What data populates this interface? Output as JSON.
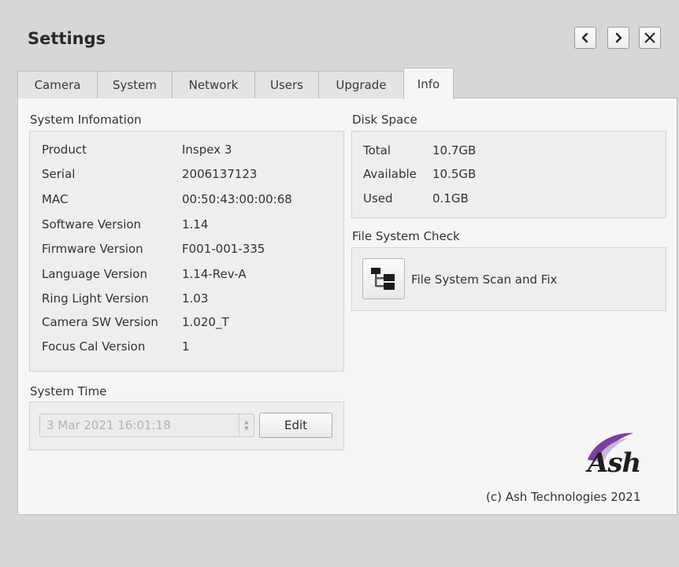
{
  "window": {
    "title": "Settings"
  },
  "nav": {
    "prev": "<",
    "next": ">",
    "close": "X"
  },
  "tabs": [
    {
      "label": "Camera"
    },
    {
      "label": "System"
    },
    {
      "label": "Network"
    },
    {
      "label": "Users"
    },
    {
      "label": "Upgrade"
    },
    {
      "label": "Info"
    }
  ],
  "active_tab": "Info",
  "system_info": {
    "heading": "System Infomation",
    "rows": [
      {
        "label": "Product",
        "value": "Inspex 3"
      },
      {
        "label": "Serial",
        "value": "2006137123"
      },
      {
        "label": "MAC",
        "value": "00:50:43:00:00:68"
      },
      {
        "label": "Software Version",
        "value": "1.14"
      },
      {
        "label": "Firmware Version",
        "value": "F001-001-335"
      },
      {
        "label": "Language Version",
        "value": "1.14-Rev-A"
      },
      {
        "label": "Ring Light Version",
        "value": "1.03"
      },
      {
        "label": "Camera SW Version",
        "value": "1.020_T"
      },
      {
        "label": "Focus Cal Version",
        "value": "1"
      }
    ]
  },
  "disk_space": {
    "heading": "Disk Space",
    "rows": [
      {
        "label": "Total",
        "value": "10.7GB"
      },
      {
        "label": "Available",
        "value": "10.5GB"
      },
      {
        "label": "Used",
        "value": "0.1GB"
      }
    ]
  },
  "fs_check": {
    "heading": "File System Check",
    "button_label": "File System Scan and Fix",
    "icon": "folder-tree-icon"
  },
  "system_time": {
    "heading": "System Time",
    "value": "3 Mar 2021 16:01:18",
    "edit_label": "Edit"
  },
  "brand": {
    "logo_text": "Ash",
    "copyright": "(c) Ash Technologies 2021",
    "logo_color": "#7b3fa0"
  }
}
